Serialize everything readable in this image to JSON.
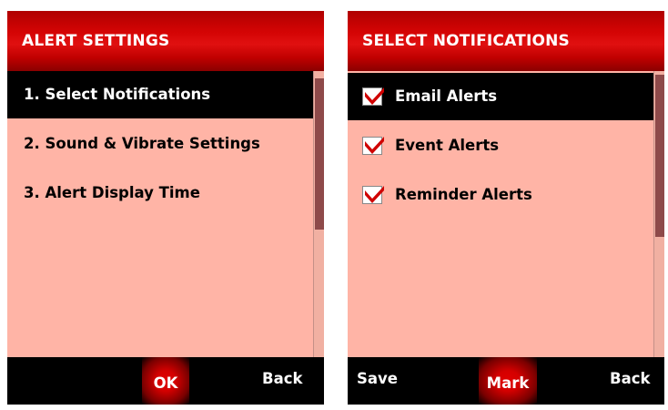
{
  "left_screen": {
    "title": "ALERT SETTINGS",
    "items": [
      {
        "label": "1. Select Notifications",
        "selected": true
      },
      {
        "label": "2. Sound & Vibrate Settings",
        "selected": false
      },
      {
        "label": "3. Alert Display Time",
        "selected": false
      }
    ],
    "softkeys": {
      "center": "OK",
      "right": "Back"
    }
  },
  "right_screen": {
    "title": "SELECT NOTIFICATIONS",
    "items": [
      {
        "label": "Email Alerts",
        "checked": true,
        "selected": true
      },
      {
        "label": "Event Alerts",
        "checked": true,
        "selected": false
      },
      {
        "label": "Reminder Alerts",
        "checked": true,
        "selected": false
      }
    ],
    "softkeys": {
      "left": "Save",
      "center": "Mark",
      "right": "Back"
    }
  },
  "colors": {
    "title_red": "#d40404",
    "background_salmon": "#ffb4a6",
    "selected_row": "#000000",
    "check_mark": "#d00000"
  },
  "icons": [
    "checkbox-checked-icon"
  ]
}
